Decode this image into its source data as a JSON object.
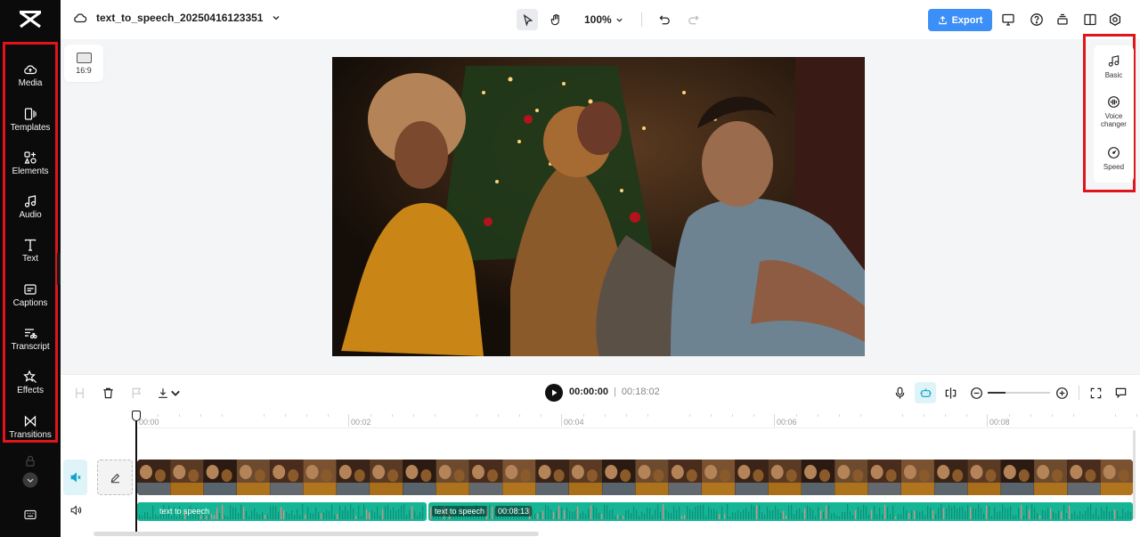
{
  "app": {
    "name": "CapCut"
  },
  "project": {
    "title": "text_to_speech_20250416123351"
  },
  "topbar": {
    "zoom": "100%",
    "export_label": "Export"
  },
  "sidebar": {
    "items": [
      {
        "label": "Media",
        "icon": "media-cloud-icon"
      },
      {
        "label": "Templates",
        "icon": "templates-icon"
      },
      {
        "label": "Elements",
        "icon": "elements-icon"
      },
      {
        "label": "Audio",
        "icon": "music-note-icon"
      },
      {
        "label": "Text",
        "icon": "text-t-icon"
      },
      {
        "label": "Captions",
        "icon": "captions-icon"
      },
      {
        "label": "Transcript",
        "icon": "transcript-icon"
      },
      {
        "label": "Effects",
        "icon": "effects-star-icon"
      },
      {
        "label": "Transitions",
        "icon": "transitions-bowtie-icon"
      }
    ]
  },
  "canvas": {
    "aspect_ratio": "16:9"
  },
  "right_panel": {
    "items": [
      {
        "label": "Basic",
        "icon": "music-note-icon"
      },
      {
        "label": "Voice changer",
        "icon": "voice-changer-icon"
      },
      {
        "label": "Speed",
        "icon": "speed-gauge-icon"
      }
    ]
  },
  "timeline": {
    "current_time": "00:00:00",
    "separator": "|",
    "total_time": "00:18:02",
    "ruler": [
      "00:00",
      "00:02",
      "00:04",
      "00:06",
      "00:08"
    ],
    "audio_clips": [
      {
        "label": "text to speech"
      },
      {
        "label": "text to speech",
        "duration": "00:08:13"
      }
    ]
  },
  "colors": {
    "accent": "#3b8ff7",
    "audio_clip": "#16b596",
    "highlight_box": "#e0141b",
    "rail": "#0b0b0b"
  }
}
